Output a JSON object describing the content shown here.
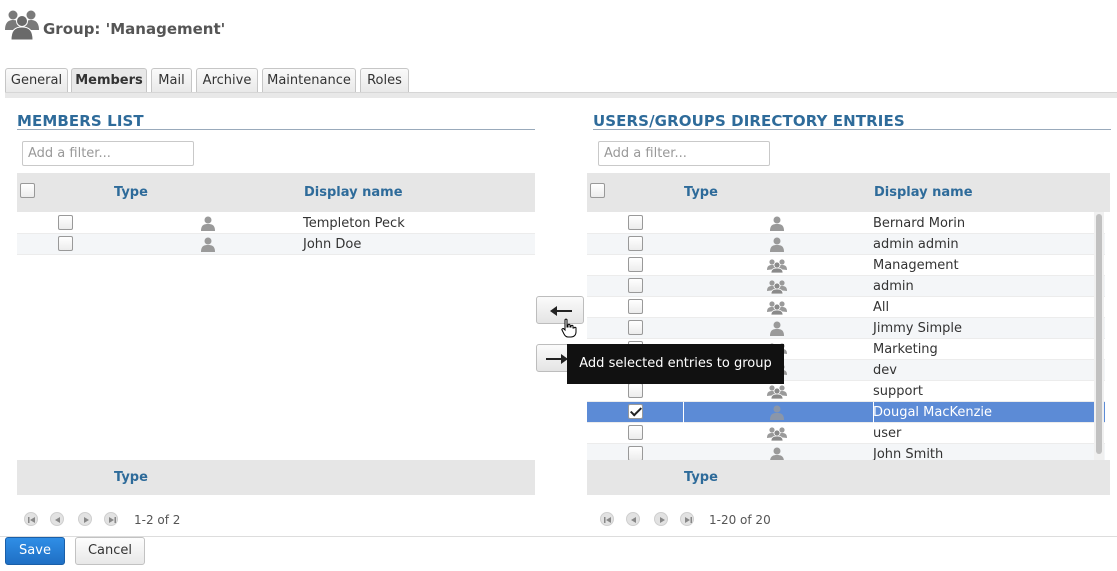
{
  "header": {
    "title": "Group: 'Management'",
    "icon": "group-icon"
  },
  "tabs": [
    {
      "label": "General"
    },
    {
      "label": "Members",
      "active": true
    },
    {
      "label": "Mail"
    },
    {
      "label": "Archive"
    },
    {
      "label": "Maintenance"
    },
    {
      "label": "Roles"
    }
  ],
  "members": {
    "title": "MEMBERS LIST",
    "filter_placeholder": "Add a filter...",
    "col_type": "Type",
    "col_display": "Display name",
    "footer_type": "Type",
    "pager_text": "1-2 of 2",
    "rows": [
      {
        "type": "user-icon",
        "name": "Templeton Peck",
        "checked": false
      },
      {
        "type": "user-icon",
        "name": "John Doe",
        "checked": false
      }
    ]
  },
  "directory": {
    "title": "USERS/GROUPS DIRECTORY ENTRIES",
    "filter_placeholder": "Add a filter...",
    "col_type": "Type",
    "col_display": "Display name",
    "footer_type": "Type",
    "pager_text": "1-20 of 20",
    "rows": [
      {
        "type": "user-icon",
        "name": "Bernard Morin",
        "checked": false
      },
      {
        "type": "user-icon",
        "name": "admin admin",
        "checked": false
      },
      {
        "type": "group-icon",
        "name": "Management",
        "checked": false
      },
      {
        "type": "group-icon",
        "name": "admin",
        "checked": false
      },
      {
        "type": "group-icon",
        "name": "All",
        "checked": false
      },
      {
        "type": "user-icon",
        "name": "Jimmy Simple",
        "checked": false
      },
      {
        "type": "group-icon",
        "name": "Marketing",
        "checked": false
      },
      {
        "type": "group-icon",
        "name": "dev",
        "checked": false
      },
      {
        "type": "group-icon",
        "name": "support",
        "checked": false
      },
      {
        "type": "user-icon",
        "name": "Dougal MacKenzie",
        "checked": true,
        "selected": true
      },
      {
        "type": "group-icon",
        "name": "user",
        "checked": false
      },
      {
        "type": "user-icon",
        "name": "John Smith",
        "checked": false
      }
    ]
  },
  "transfer": {
    "add_icon": "arrow-left-icon",
    "remove_icon": "arrow-right-icon",
    "tooltip": "Add selected entries to group"
  },
  "actions": {
    "save": "Save",
    "cancel": "Cancel"
  },
  "colors": {
    "accent": "#2e6b9a",
    "selected_row": "#5c8bd6",
    "save_button": "#1f6fc4"
  }
}
